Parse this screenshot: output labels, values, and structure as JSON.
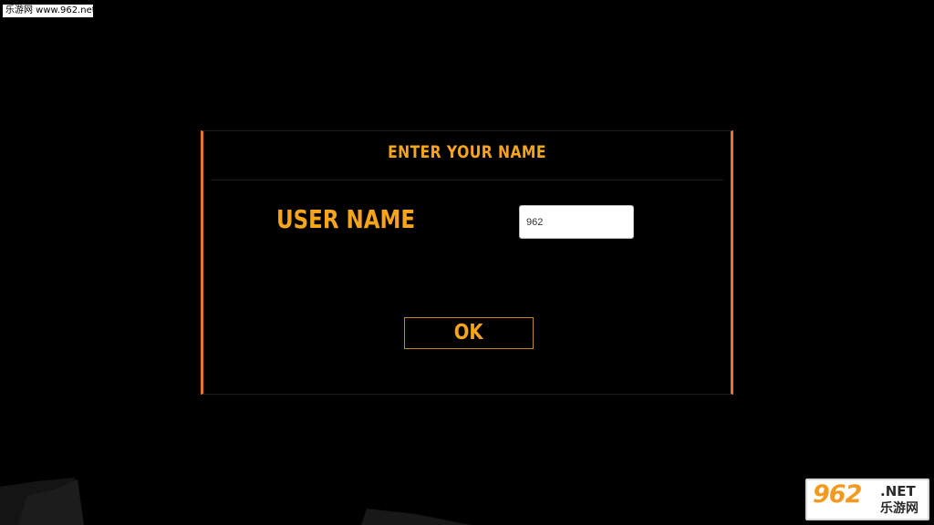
{
  "watermark": {
    "top_text": "乐游网 www.962.net",
    "logo_main": "962",
    "logo_suffix": ".NET",
    "logo_sub": "乐游网"
  },
  "dialog": {
    "title": "ENTER YOUR NAME",
    "field_label": "USER NAME",
    "input_value": "962",
    "ok_label": "OK"
  },
  "colors": {
    "accent": "#f5a41c",
    "border": "#e8742d",
    "background": "#000000"
  }
}
